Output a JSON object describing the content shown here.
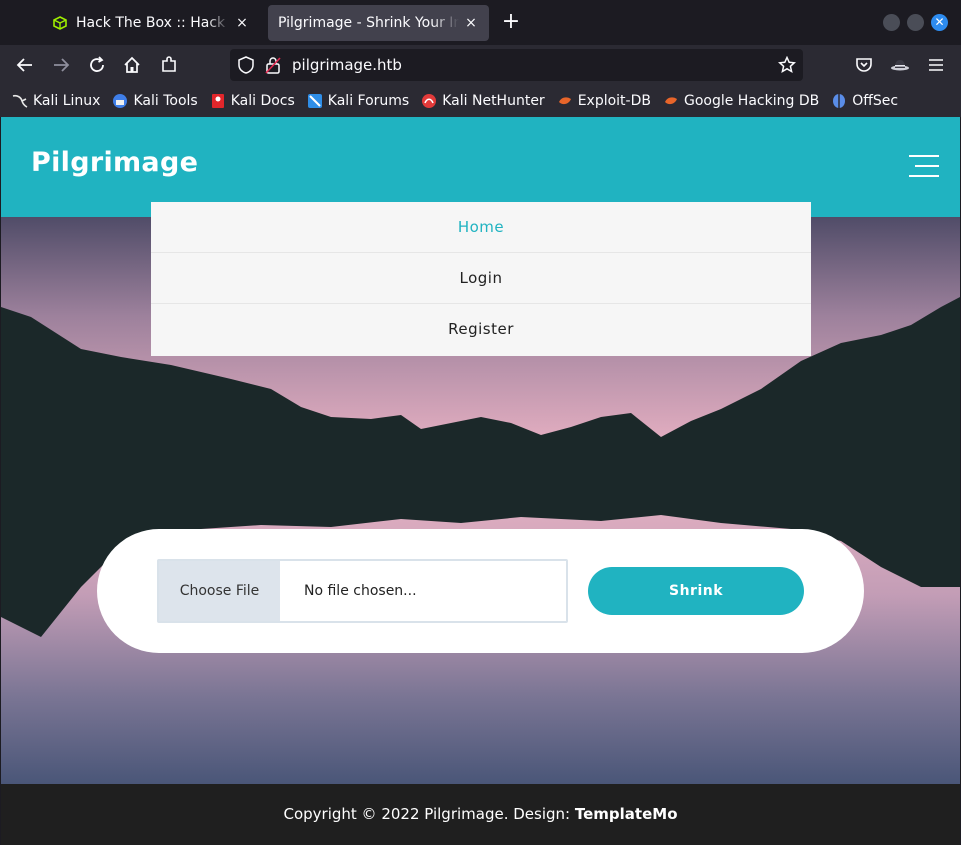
{
  "browser": {
    "tabs": [
      {
        "title": "Hack The Box :: Hack The Box",
        "active": false,
        "icon": "htb-cube-icon"
      },
      {
        "title": "Pilgrimage - Shrink Your Images",
        "active": true,
        "icon": "none"
      }
    ],
    "new_tab": "+",
    "close_glyph": "×",
    "url": "pilgrimage.htb",
    "bookmarks": [
      {
        "label": "Kali Linux",
        "icon": "kali-dragon-icon",
        "color": "#e8e8e8"
      },
      {
        "label": "Kali Tools",
        "icon": "kali-tools-icon",
        "color": "#3f7ee8"
      },
      {
        "label": "Kali Docs",
        "icon": "kali-docs-icon",
        "color": "#e2262b"
      },
      {
        "label": "Kali Forums",
        "icon": "kali-forums-icon",
        "color": "#2f8ee8"
      },
      {
        "label": "Kali NetHunter",
        "icon": "nethunter-icon",
        "color": "#e23a3a"
      },
      {
        "label": "Exploit-DB",
        "icon": "exploitdb-icon",
        "color": "#e8652a"
      },
      {
        "label": "Google Hacking DB",
        "icon": "ghdb-icon",
        "color": "#e8652a"
      },
      {
        "label": "OffSec",
        "icon": "offsec-icon",
        "color": "#5a8de8"
      }
    ]
  },
  "site": {
    "brand": "Pilgrimage",
    "accent": "#20b3c1",
    "menu": [
      {
        "label": "Home",
        "current": true
      },
      {
        "label": "Login",
        "current": false
      },
      {
        "label": "Register",
        "current": false
      }
    ],
    "upload": {
      "choose_label": "Choose File",
      "file_placeholder": "No file chosen...",
      "submit_label": "Shrink"
    },
    "footer": {
      "text": "Copyright © 2022 Pilgrimage. Design: ",
      "link": "TemplateMo"
    }
  }
}
